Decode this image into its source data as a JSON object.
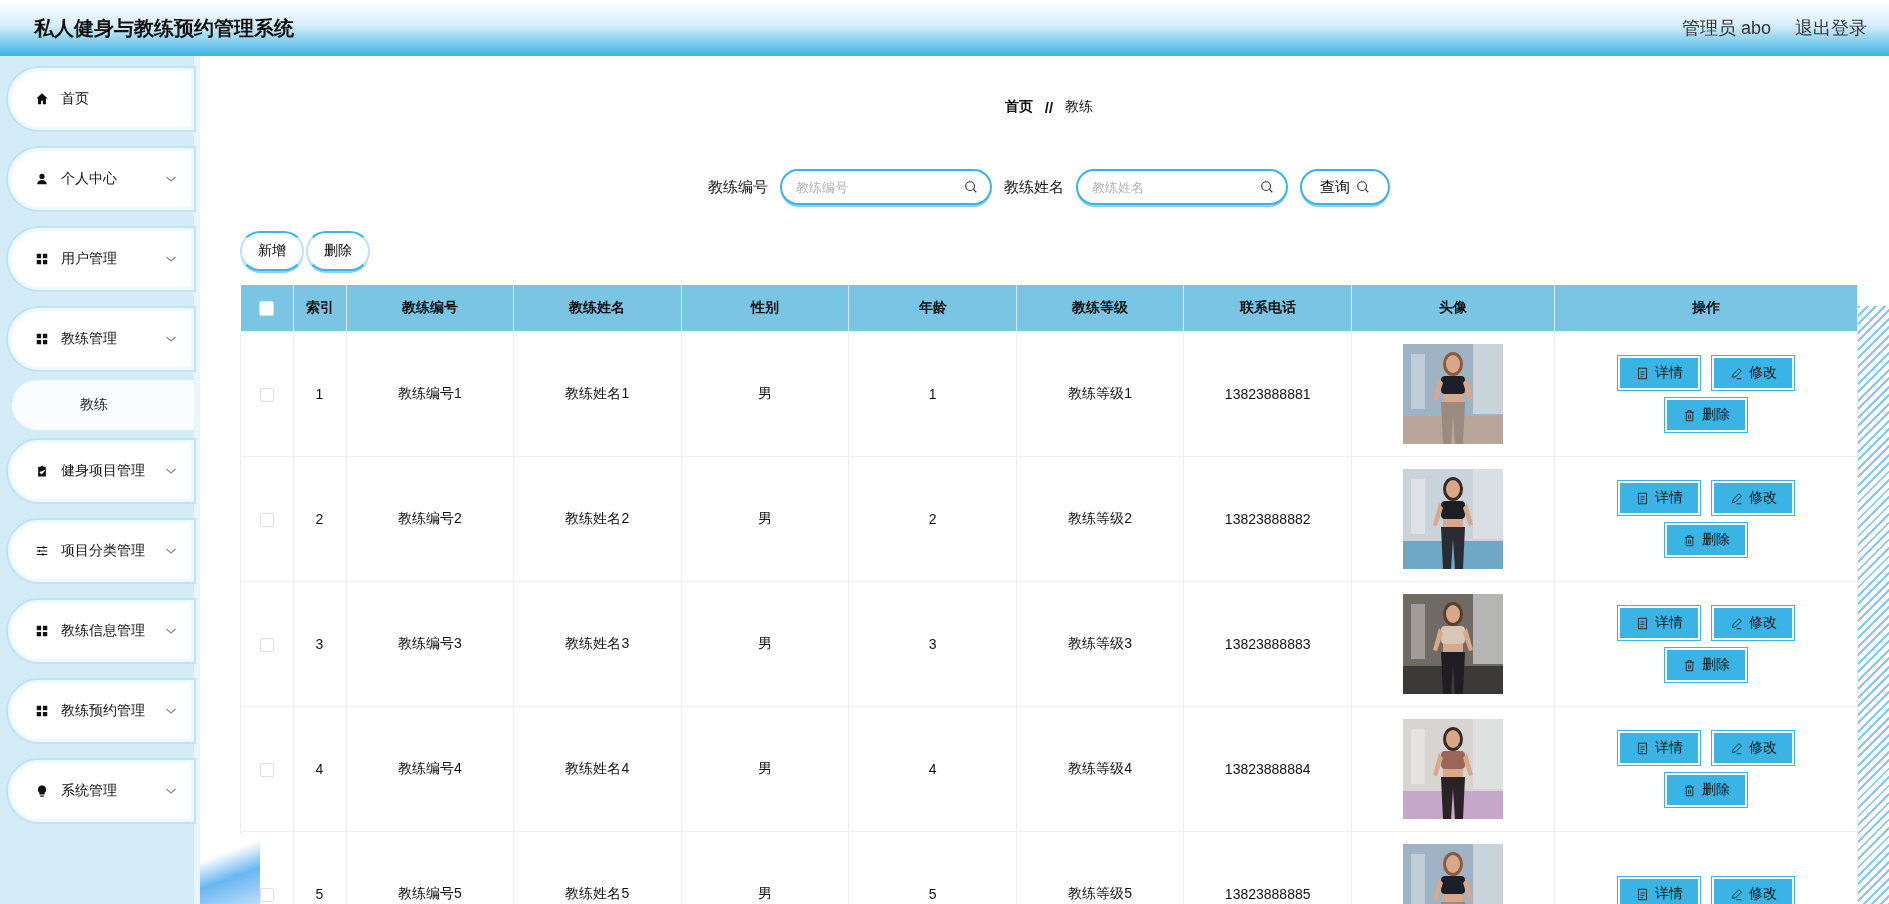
{
  "header": {
    "title": "私人健身与教练预约管理系统",
    "user": "管理员 abo",
    "logout": "退出登录"
  },
  "sidebar": {
    "items": [
      {
        "label": "首页",
        "caret": false,
        "selected": false
      },
      {
        "label": "个人中心",
        "caret": true,
        "selected": false
      },
      {
        "label": "用户管理",
        "caret": true,
        "selected": false
      },
      {
        "label": "教练管理",
        "caret": true,
        "selected": false,
        "children": [
          {
            "label": "教练",
            "selected": true
          }
        ]
      },
      {
        "label": "健身项目管理",
        "caret": true,
        "selected": false
      },
      {
        "label": "项目分类管理",
        "caret": true,
        "selected": false
      },
      {
        "label": "教练信息管理",
        "caret": true,
        "selected": false
      },
      {
        "label": "教练预约管理",
        "caret": true,
        "selected": false
      },
      {
        "label": "系统管理",
        "caret": true,
        "selected": false
      }
    ]
  },
  "breadcrumb": {
    "items": [
      "首页",
      "教练"
    ],
    "separator": "//"
  },
  "search": {
    "fields": [
      {
        "label": "教练编号",
        "placeholder": "教练编号"
      },
      {
        "label": "教练姓名",
        "placeholder": "教练姓名"
      }
    ],
    "button": "查询"
  },
  "toolbar": [
    "新增",
    "删除"
  ],
  "table": {
    "select_all_checked": false,
    "columns": [
      "索引",
      "教练编号",
      "教练姓名",
      "性别",
      "年龄",
      "教练等级",
      "联系电话",
      "头像",
      "操作"
    ],
    "rows": [
      {
        "checked": false,
        "cells": [
          "1",
          "教练编号1",
          "教练姓名1",
          "男",
          "1",
          "教练等级1",
          "13823888881"
        ],
        "actions": [
          "详情",
          "修改",
          "删除"
        ]
      },
      {
        "checked": false,
        "cells": [
          "2",
          "教练编号2",
          "教练姓名2",
          "男",
          "2",
          "教练等级2",
          "13823888882"
        ],
        "actions": [
          "详情",
          "修改",
          "删除"
        ]
      },
      {
        "checked": false,
        "cells": [
          "3",
          "教练编号3",
          "教练姓名3",
          "男",
          "3",
          "教练等级3",
          "13823888883"
        ],
        "actions": [
          "详情",
          "修改",
          "删除"
        ]
      },
      {
        "checked": false,
        "cells": [
          "4",
          "教练编号4",
          "教练姓名4",
          "男",
          "4",
          "教练等级4",
          "13823888884"
        ],
        "actions": [
          "详情",
          "修改",
          "删除"
        ]
      },
      {
        "checked": false,
        "cells": [
          "5",
          "教练编号5",
          "教练姓名5",
          "男",
          "5",
          "教练等级5",
          "13823888885"
        ],
        "actions": [
          "详情",
          "修改"
        ]
      }
    ]
  }
}
